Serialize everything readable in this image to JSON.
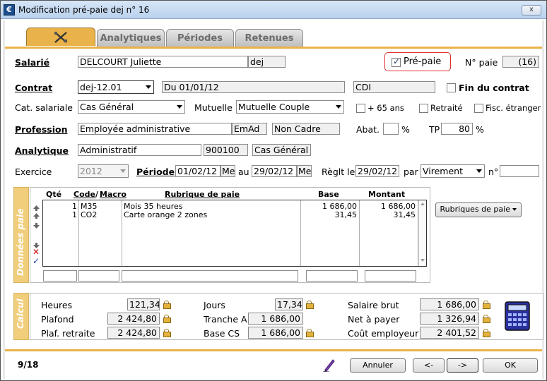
{
  "window": {
    "title": "Modification pré-paie dej n° 16",
    "close": "x"
  },
  "tabs": [
    {
      "label": ""
    },
    {
      "label": "Analytiques"
    },
    {
      "label": "Périodes"
    },
    {
      "label": "Retenues"
    }
  ],
  "salarie": {
    "label": "Salarié",
    "name": "DELCOURT Juliette",
    "code": "dej",
    "prepaie_label": "Pré-paie",
    "prepaie_checked": true,
    "npaie_label": "N° paie",
    "npaie": "(16)"
  },
  "contrat": {
    "label": "Contrat",
    "value": "dej-12.01",
    "du": "Du 01/01/12",
    "type": "CDI",
    "fin_label": "Fin du contrat"
  },
  "cat": {
    "label": "Cat. salariale",
    "value": "Cas Général",
    "mutuelle_label": "Mutuelle",
    "mutuelle": "Mutuelle Couple",
    "plus65": "+ 65 ans",
    "retraite": "Retraité",
    "fisc": "Fisc. étranger"
  },
  "profession": {
    "label": "Profession",
    "value": "Employée administrative",
    "code": "EmAd",
    "statut": "Non Cadre",
    "abat_label": "Abat.",
    "abat": "",
    "pct1": "%",
    "tp_label": "TP",
    "tp": "80",
    "pct2": "%"
  },
  "analytique": {
    "label": "Analytique",
    "value": "Administratif",
    "code": "900100",
    "cas": "Cas Général"
  },
  "exercice": {
    "label": "Exercice",
    "value": "2012",
    "periode_label": "Période",
    "debut": "01/02/12",
    "debut_unit": "Me",
    "au": "au",
    "fin": "29/02/12",
    "fin_unit": "Me",
    "reglt_label": "Règlt le",
    "reglt": "29/02/12",
    "par": "par",
    "mode": "Virement",
    "no": "n°",
    "no_value": ""
  },
  "donnees": {
    "side": "Données paie",
    "headers": {
      "qte": "Qté",
      "code": "Code",
      "slash": "/",
      "macro": "Macro",
      "rubrique": "Rubrique de paie",
      "base": "Base",
      "montant": "Montant"
    },
    "rows": [
      {
        "qte": "1",
        "code": "M35",
        "rubrique": "Mois 35 heures",
        "base": "1 686,00",
        "montant": "1 686,00"
      },
      {
        "qte": "1",
        "code": "CO2",
        "rubrique": "Carte orange 2 zones",
        "base": "31,45",
        "montant": "31,45"
      }
    ],
    "rubriques_button": "Rubriques de paie"
  },
  "calcul": {
    "side": "Calcul",
    "col1": [
      {
        "label": "Heures",
        "value": "121,34"
      },
      {
        "label": "Plafond",
        "value": "2 424,80"
      },
      {
        "label": "Plaf. retraite",
        "value": "2 424,80"
      }
    ],
    "col2": [
      {
        "label": "Jours",
        "value": "17,34"
      },
      {
        "label": "Tranche A",
        "value": "1 686,00"
      },
      {
        "label": "Base CS",
        "value": "1 686,00"
      }
    ],
    "col3": [
      {
        "label": "Salaire brut",
        "value": "1 686,00"
      },
      {
        "label": "Net à payer",
        "value": "1 326,94"
      },
      {
        "label": "Coût employeur",
        "value": "2 401,52"
      }
    ]
  },
  "footer": {
    "counter": "9/18",
    "annuler": "Annuler",
    "prev": "<-",
    "next": "->",
    "ok": "OK"
  },
  "colors": {
    "accent": "#e9b24a",
    "side": "#f1ce7c",
    "highlight": "#e03030"
  }
}
